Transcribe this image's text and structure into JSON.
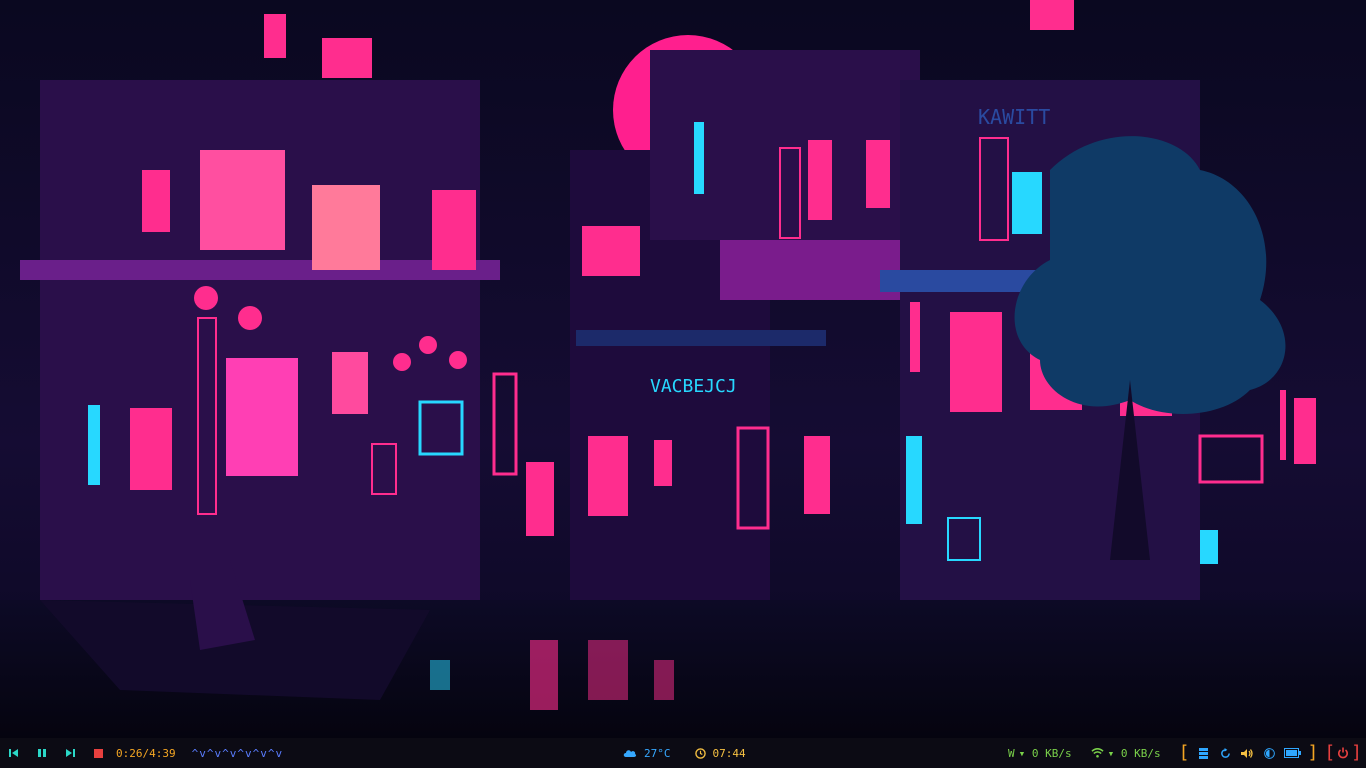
{
  "colors": {
    "bar_bg": "#0c0b14",
    "media_icon": "#2bd8c8",
    "stop": "#e8403f",
    "orange": "#f5a623",
    "viz": "#5a7dff",
    "weather": "#36a8ff",
    "clock": "#f5c042",
    "net": "#7ad14a",
    "blue": "#2fa7ff",
    "red": "#e8403f"
  },
  "media": {
    "prev_icon": "skip-previous-icon",
    "pause_icon": "pause-icon",
    "next_icon": "skip-next-icon",
    "stop_icon": "stop-icon",
    "time": "0:26/4:39",
    "visualizer": "^v^v^v^v^v^v"
  },
  "weather": {
    "icon": "cloud-icon",
    "temp": "27°C"
  },
  "clock": {
    "icon": "clock-icon",
    "time": "07:44"
  },
  "network": {
    "wired_label": "W",
    "wired_speed": "▾ 0 KB/s",
    "wifi_icon": "wifi-icon",
    "wifi_speed": "▾ 0 KB/s"
  },
  "tray": {
    "open_bracket": "[",
    "close_bracket": "]",
    "icons": [
      "storage-icon",
      "update-icon",
      "volume-icon",
      "brightness-icon",
      "battery-icon"
    ],
    "power_open": "[",
    "power_close": "]",
    "power_icon": "power-icon"
  }
}
